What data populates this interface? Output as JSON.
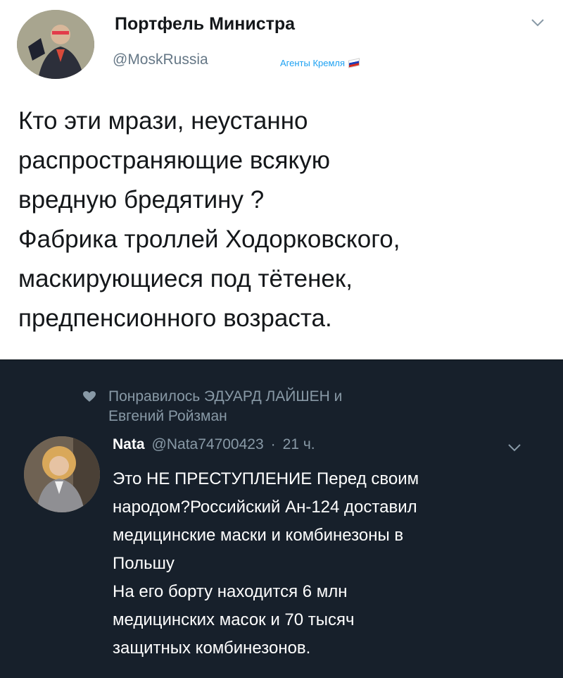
{
  "top_tweet": {
    "author_name": "Портфель Министра",
    "author_handle": "@MoskRussia",
    "badge_text": "Агенты Кремля",
    "body": "Кто эти мрази, неустанно\nраспространяющие всякую\nвредную бредятину ?\nФабрика троллей Ходорковского,\nмаскирующиеся под тётенек,\nпредпенсионного возраста."
  },
  "reply_tweet": {
    "liked_by": "Понравилось ЭДУАРД ЛАЙШЕН и\nЕвгений Ройзман",
    "author_name": "Nata",
    "author_handle": "@Nata74700423",
    "separator": "·",
    "timestamp": "21 ч.",
    "body": "Это НЕ ПРЕСТУПЛЕНИЕ Перед своим\nнародом?Российский Ан-124 доставил\nмедицинские маски и комбинезоны в\nПольшу\nНа его борту находится 6 млн\nмедицинских масок и 70 тысяч\nзащитных комбинезонов."
  },
  "colors": {
    "dark_background": "#17202b",
    "muted_text": "#8899a6",
    "link_blue": "#1da1f2"
  },
  "icons": [
    "chevron-down-icon",
    "heart-icon",
    "flag-icon"
  ]
}
